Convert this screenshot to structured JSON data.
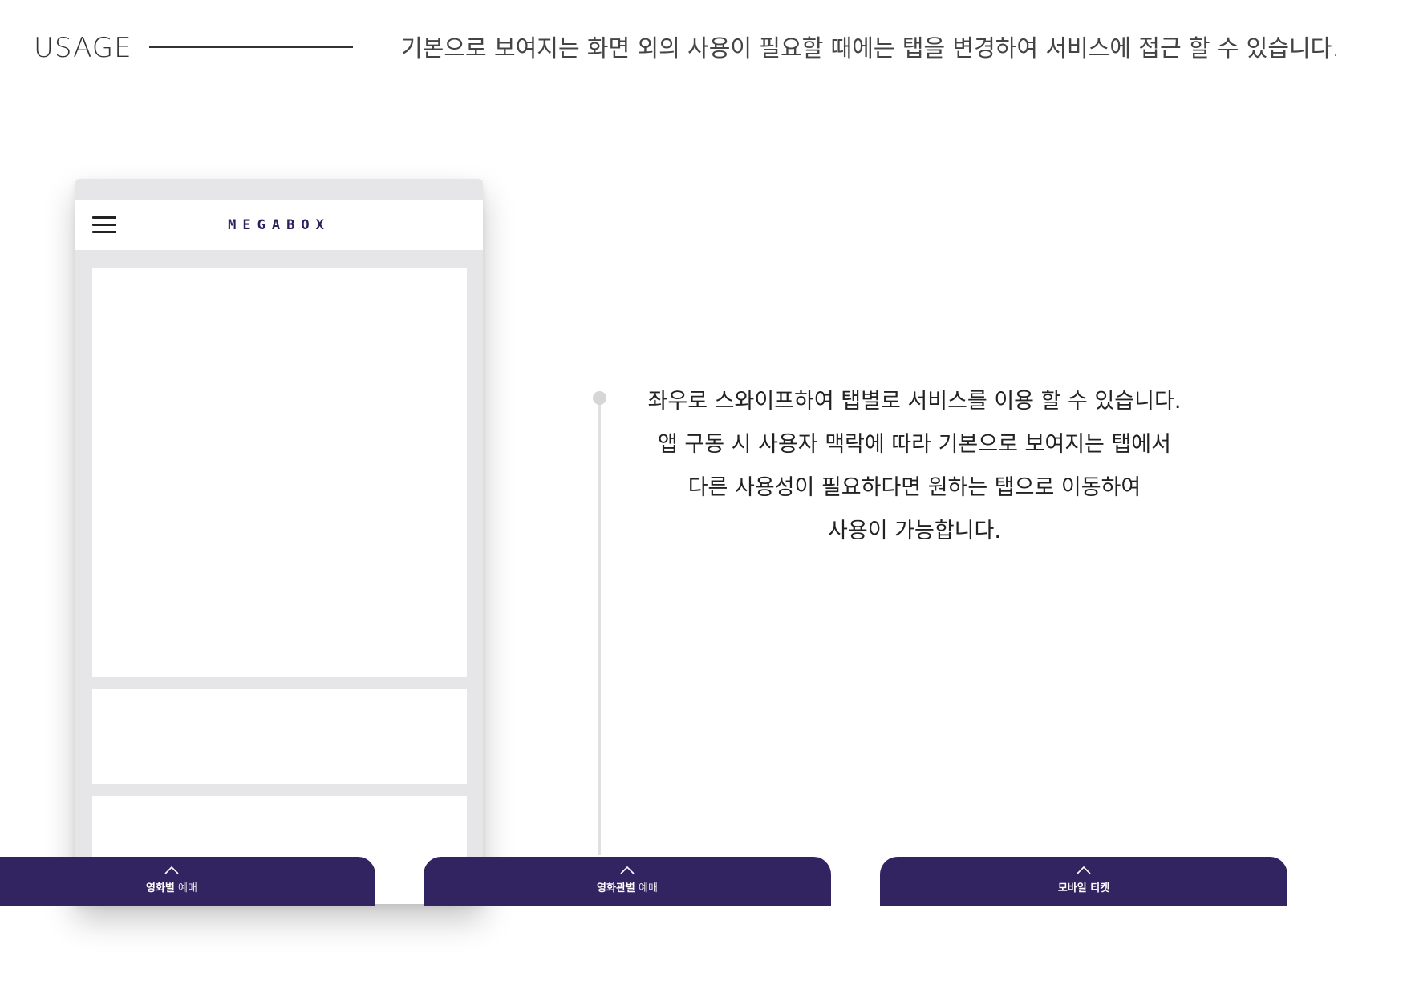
{
  "header": {
    "usage_label": "USAGE",
    "description": "기본으로 보여지는 화면 외의 사용이 필요할 때에는 탭을 변경하여 서비스에 접근 할 수 있습니다."
  },
  "phone": {
    "logo": "MEGABOX",
    "menu_icon": "hamburger-menu-icon"
  },
  "description_lines": [
    "좌우로 스와이프하여 탭별로 서비스를 이용 할 수 있습니다.",
    "앱 구동 시 사용자 맥락에 따라 기본으로 보여지는 탭에서",
    "다른 사용성이 필요하다면 원하는 탭으로 이동하여",
    "사용이 가능합니다."
  ],
  "tabs": [
    {
      "strong": "영화별",
      "light": " 예매",
      "icon": "chevron-up-icon"
    },
    {
      "strong": "영화관별",
      "light": " 예매",
      "icon": "chevron-up-icon"
    },
    {
      "strong": "모바일 티켓",
      "light": "",
      "icon": "chevron-up-icon"
    }
  ],
  "colors": {
    "tab_background": "#322461",
    "logo": "#2e1f5c",
    "phone_frame": "#e6e6e8",
    "timeline": "#e0e0e0"
  }
}
